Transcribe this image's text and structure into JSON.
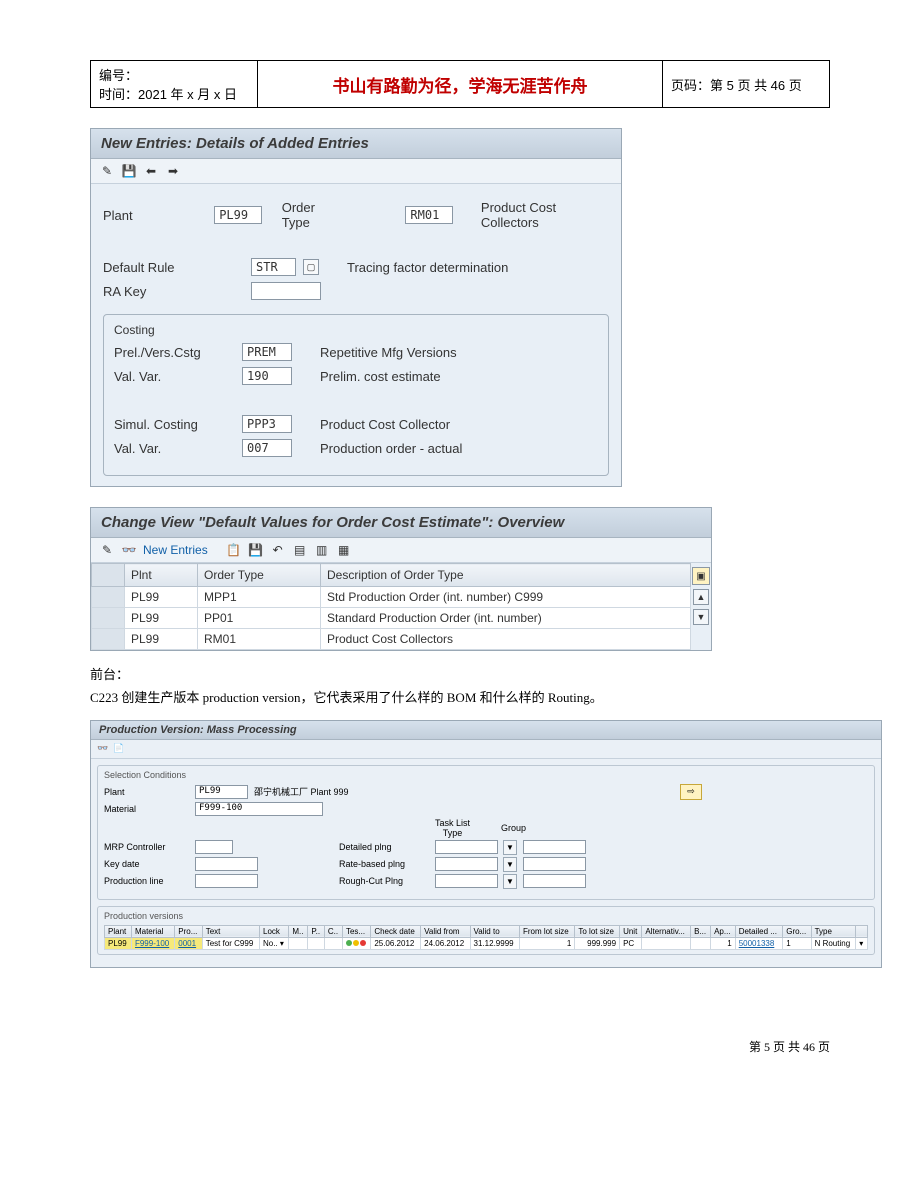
{
  "header": {
    "id_label": "编号：",
    "time_label": "时间：2021 年 x 月 x 日",
    "title": "书山有路勤为径，学海无涯苦作舟",
    "page_label": "页码：第 5 页  共 46 页"
  },
  "panel1": {
    "title": "New Entries: Details of Added Entries",
    "fields": {
      "plant_label": "Plant",
      "plant_value": "PL99",
      "order_type_label": "Order Type",
      "order_type_value": "RM01",
      "order_type_desc": "Product Cost Collectors",
      "default_rule_label": "Default Rule",
      "default_rule_value": "STR",
      "default_rule_desc": "Tracing factor determination",
      "ra_key_label": "RA Key",
      "ra_key_value": ""
    },
    "costing": {
      "box_title": "Costing",
      "prel_label": "Prel./Vers.Cstg",
      "prel_value": "PREM",
      "prel_desc": "Repetitive Mfg Versions",
      "val1_label": "Val. Var.",
      "val1_value": "190",
      "val1_desc": "Prelim. cost estimate",
      "simul_label": "Simul. Costing",
      "simul_value": "PPP3",
      "simul_desc": "Product Cost Collector",
      "val2_label": "Val. Var.",
      "val2_value": "007",
      "val2_desc": "Production order - actual"
    }
  },
  "panel2": {
    "title": "Change View \"Default Values for Order Cost Estimate\": Overview",
    "new_entries_label": "New Entries",
    "columns": {
      "plnt": "Plnt",
      "order_type": "Order Type",
      "desc": "Description of Order Type"
    },
    "rows": [
      {
        "plnt": "PL99",
        "ot": "MPP1",
        "desc": "Std Production Order (int. number) C999"
      },
      {
        "plnt": "PL99",
        "ot": "PP01",
        "desc": "Standard Production Order (int. number)"
      },
      {
        "plnt": "PL99",
        "ot": "RM01",
        "desc": "Product Cost Collectors"
      }
    ]
  },
  "text": {
    "line1": "前台：",
    "line2": "C223 创建生产版本 production version，它代表采用了什么样的 BOM 和什么样的 Routing。"
  },
  "panel3": {
    "title": "Production Version: Mass Processing",
    "sel_title": "Selection Conditions",
    "plant_label": "Plant",
    "plant_value": "PL99",
    "plant_desc": "邵宁机械工厂 Plant 999",
    "material_label": "Material",
    "material_value": "F999-100",
    "mrp_label": "MRP Controller",
    "key_label": "Key date",
    "prod_line_label": "Production line",
    "col_tlt": "Task List Type",
    "col_grp": "Group",
    "det_label": "Detailed plng",
    "rate_label": "Rate-based plng",
    "rough_label": "Rough-Cut Plng",
    "versions_title": "Production versions",
    "headers": [
      "Plant",
      "Material",
      "Pro...",
      "Text",
      "Lock",
      "M..",
      "P..",
      "C..",
      "Tes...",
      "Check date",
      "Valid from",
      "Valid to",
      "From lot size",
      "To lot size",
      "Unit",
      "Alternativ...",
      "B...",
      "Ap...",
      "Detailed ...",
      "Gro...",
      "Type",
      ""
    ],
    "row": {
      "plant": "PL99",
      "material": "F999-100",
      "prod": "0001",
      "text": "Test for C999",
      "lock": "No..",
      "check_date": "25.06.2012",
      "valid_from": "24.06.2012",
      "valid_to": "31.12.9999",
      "from_lot": "1",
      "to_lot": "999.999",
      "unit": "PC",
      "alt": "1",
      "detailed": "50001338",
      "gro": "1",
      "type": "N Routing"
    }
  },
  "footer": "第  5  页  共  46  页"
}
